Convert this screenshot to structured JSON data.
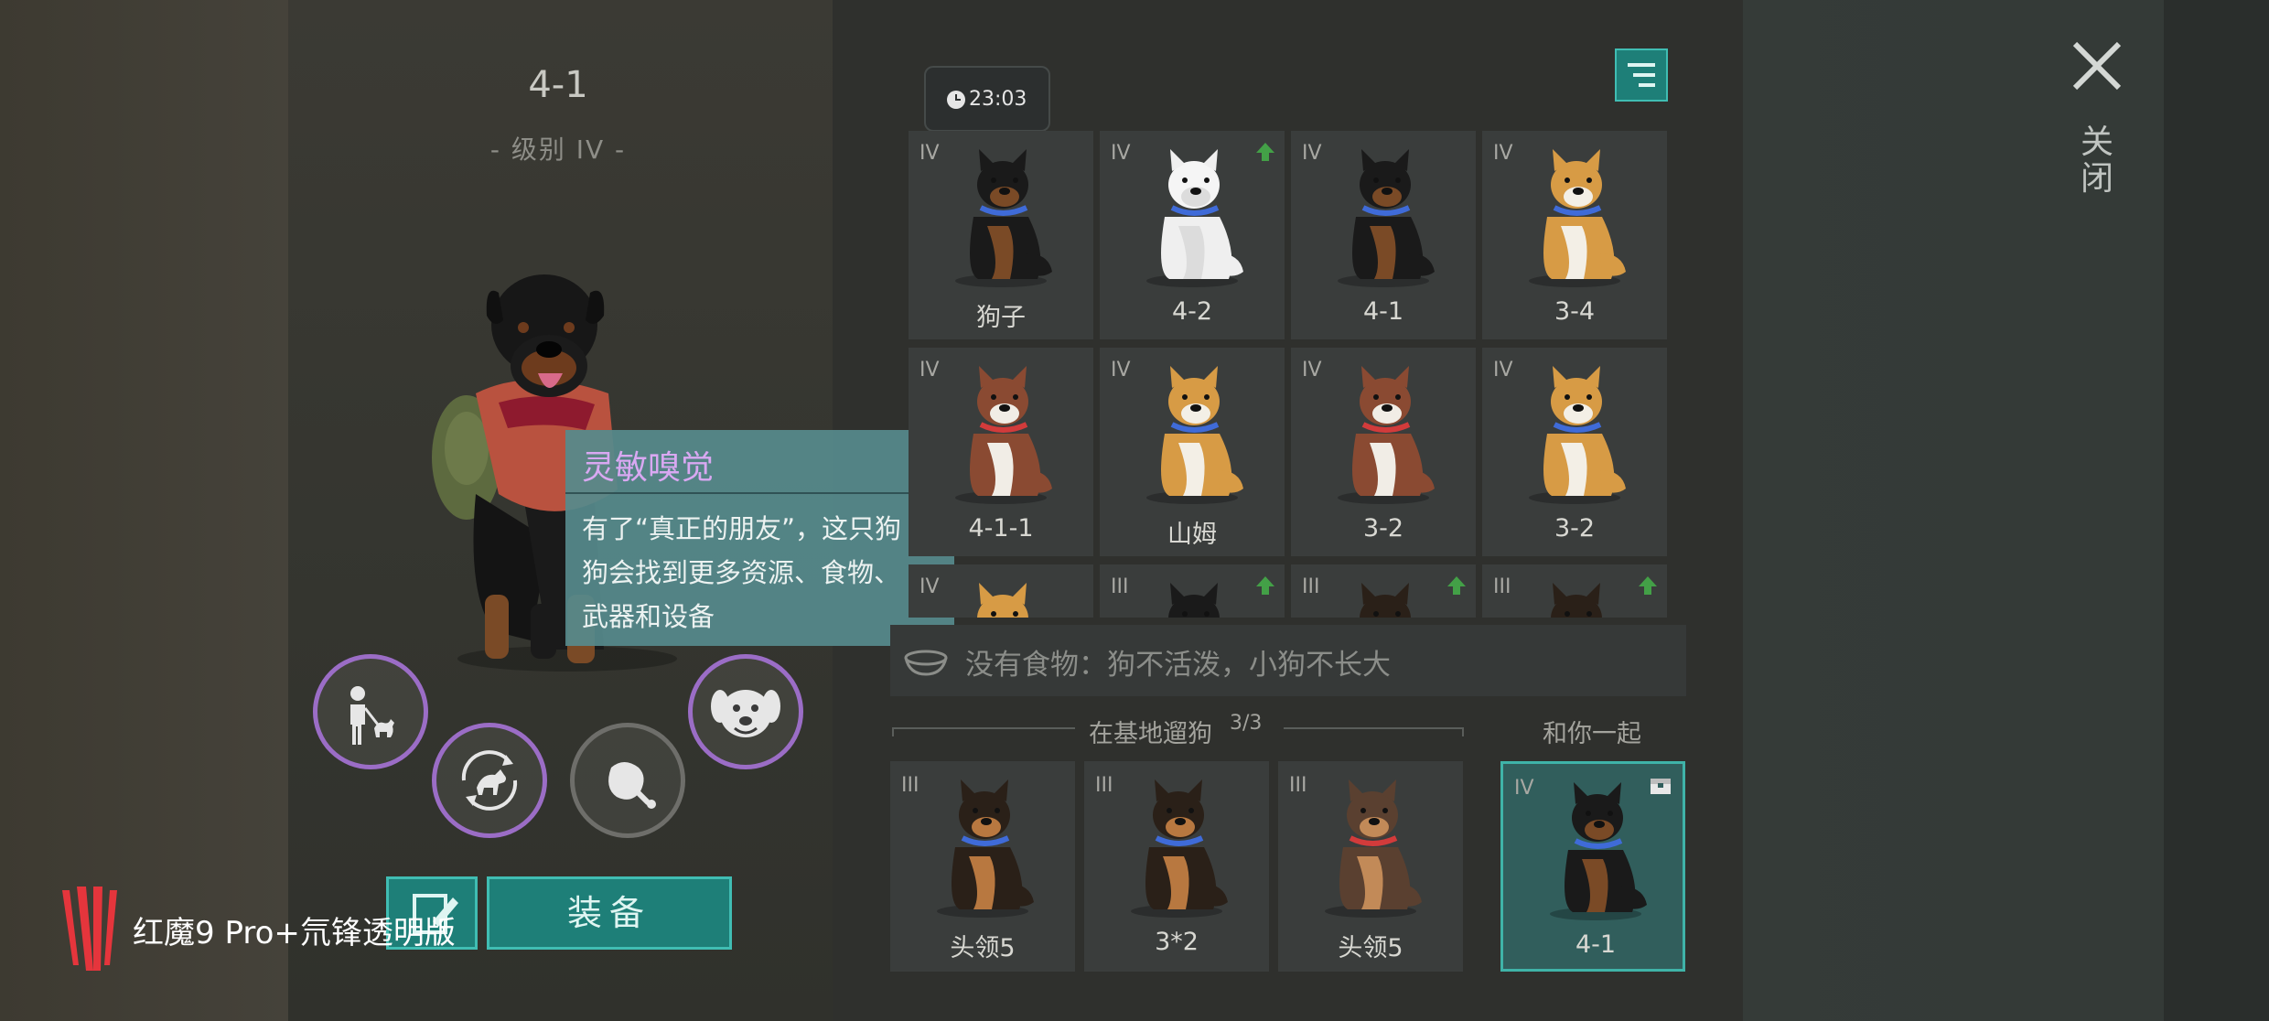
{
  "colors": {
    "accent": "#1e7f78",
    "accent_border": "#40bdb3",
    "tooltip_title": "#d9a8f2",
    "upgrade_arrow": "#43a047"
  },
  "dog_detail": {
    "name": "4-1",
    "level": "- 级别 IV -",
    "icons": [
      "walk-dog-icon",
      "dog-rotate-icon",
      "meat-icon",
      "dog-face-icon"
    ]
  },
  "tooltip": {
    "title": "灵敏嗅觉",
    "lines": [
      "有了“真正的朋友”，这只狗",
      "狗会找到更多资源、食物、",
      "武器和设备"
    ]
  },
  "buttons": {
    "equip": "装备"
  },
  "watermark": "红魔9 Pro+氘锋透明版",
  "timer": "23:03",
  "dog_grid": [
    {
      "level": "IV",
      "name": "狗子",
      "breed": "rottweiler",
      "upgrade": false
    },
    {
      "level": "IV",
      "name": "4-2",
      "breed": "white",
      "upgrade": true
    },
    {
      "level": "IV",
      "name": "4-1",
      "breed": "rottweiler",
      "upgrade": false
    },
    {
      "level": "IV",
      "name": "3-4",
      "breed": "shiba",
      "upgrade": false
    },
    {
      "level": "IV",
      "name": "4-1-1",
      "breed": "husky",
      "upgrade": false
    },
    {
      "level": "IV",
      "name": "山姆",
      "breed": "shiba",
      "upgrade": false
    },
    {
      "level": "IV",
      "name": "3-2",
      "breed": "husky",
      "upgrade": false
    },
    {
      "level": "IV",
      "name": "3-2",
      "breed": "shiba",
      "upgrade": false
    },
    {
      "level": "IV",
      "name": "",
      "breed": "shiba",
      "upgrade": false
    },
    {
      "level": "III",
      "name": "",
      "breed": "rottweiler",
      "upgrade": true
    },
    {
      "level": "III",
      "name": "",
      "breed": "shepherd",
      "upgrade": true
    },
    {
      "level": "III",
      "name": "",
      "breed": "shepherd",
      "upgrade": true
    }
  ],
  "food_status": "没有食物：狗不活泼，小狗不长大",
  "walking": {
    "label": "在基地遛狗",
    "count": "3/3",
    "dogs": [
      {
        "level": "III",
        "name": "头领5",
        "breed": "shepherd"
      },
      {
        "level": "III",
        "name": "3*2",
        "breed": "shepherd"
      },
      {
        "level": "III",
        "name": "头领5",
        "breed": "shepherd_light"
      }
    ]
  },
  "with_you": {
    "label": "和你一起",
    "dog": {
      "level": "IV",
      "name": "4-1",
      "breed": "rottweiler"
    }
  },
  "close_label": "关闭"
}
